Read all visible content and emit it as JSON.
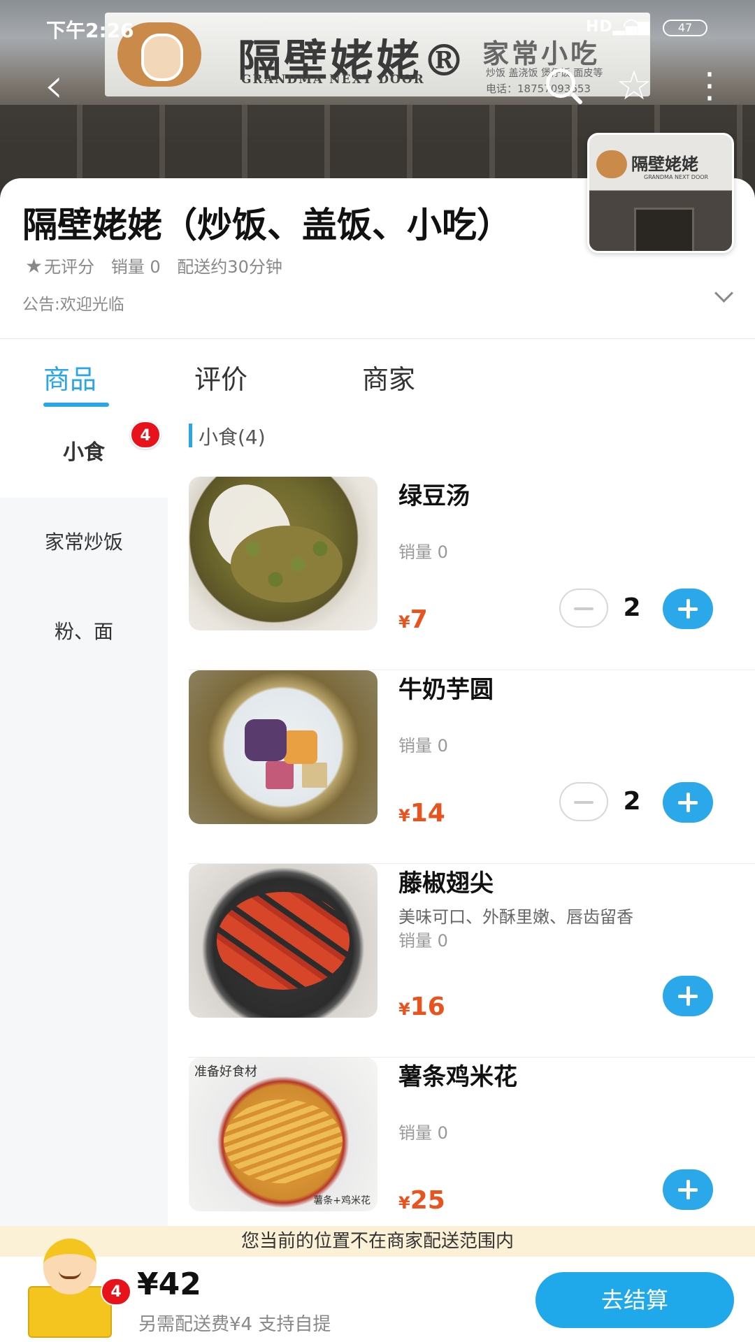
{
  "status_bar": {
    "time": "下午2:26",
    "signal": "HD",
    "battery": "47"
  },
  "hero": {
    "sign_name": "隔壁姥姥®",
    "sign_en": "GRANDMA NEXT DOOR",
    "sign_sub": "家常小吃",
    "sign_tags": "炒饭  盖浇饭  煲仔饭  面皮等",
    "sign_phone": "电话：18757093653",
    "thumb_name": "隔壁姥姥",
    "thumb_en": "GRANDMA NEXT DOOR"
  },
  "store": {
    "name": "隔壁姥姥（炒饭、盖饭、小吃）",
    "rating": "无评分",
    "sales": "销量 0",
    "delivery_time": "配送约30分钟",
    "notice": "公告:欢迎光临"
  },
  "tabs": [
    {
      "label": "商品",
      "active": true
    },
    {
      "label": "评价",
      "active": false
    },
    {
      "label": "商家",
      "active": false
    }
  ],
  "categories": [
    {
      "label": "小食",
      "active": true,
      "badge": "4"
    },
    {
      "label": "家常炒饭",
      "active": false
    },
    {
      "label": "粉、面",
      "active": false
    }
  ],
  "section_title": "小食(4)",
  "products": [
    {
      "name": "绿豆汤",
      "desc": "",
      "sales": "销量 0",
      "price_symbol": "¥",
      "price": "7",
      "qty": "2"
    },
    {
      "name": "牛奶芋圆",
      "desc": "",
      "sales": "销量 0",
      "price_symbol": "¥",
      "price": "14",
      "qty": "2"
    },
    {
      "name": "藤椒翅尖",
      "desc": "美味可口、外酥里嫩、唇齿留香",
      "sales": "销量 0",
      "price_symbol": "¥",
      "price": "16",
      "qty": ""
    },
    {
      "name": "薯条鸡米花",
      "desc": "",
      "sales": "销量 0",
      "price_symbol": "¥",
      "price": "25",
      "qty": "",
      "img_label": "准备好食材",
      "img_label2": "薯条+鸡米花"
    }
  ],
  "delivery_notice": "您当前的位置不在商家配送范围内",
  "cart": {
    "badge": "4",
    "total": "¥42",
    "sub": "另需配送费¥4  支持自提",
    "checkout_label": "去结算"
  },
  "colors": {
    "accent": "#29a6e8",
    "price": "#e9531e",
    "badge": "#e8121b",
    "notice_bg": "#fbf1d7"
  }
}
